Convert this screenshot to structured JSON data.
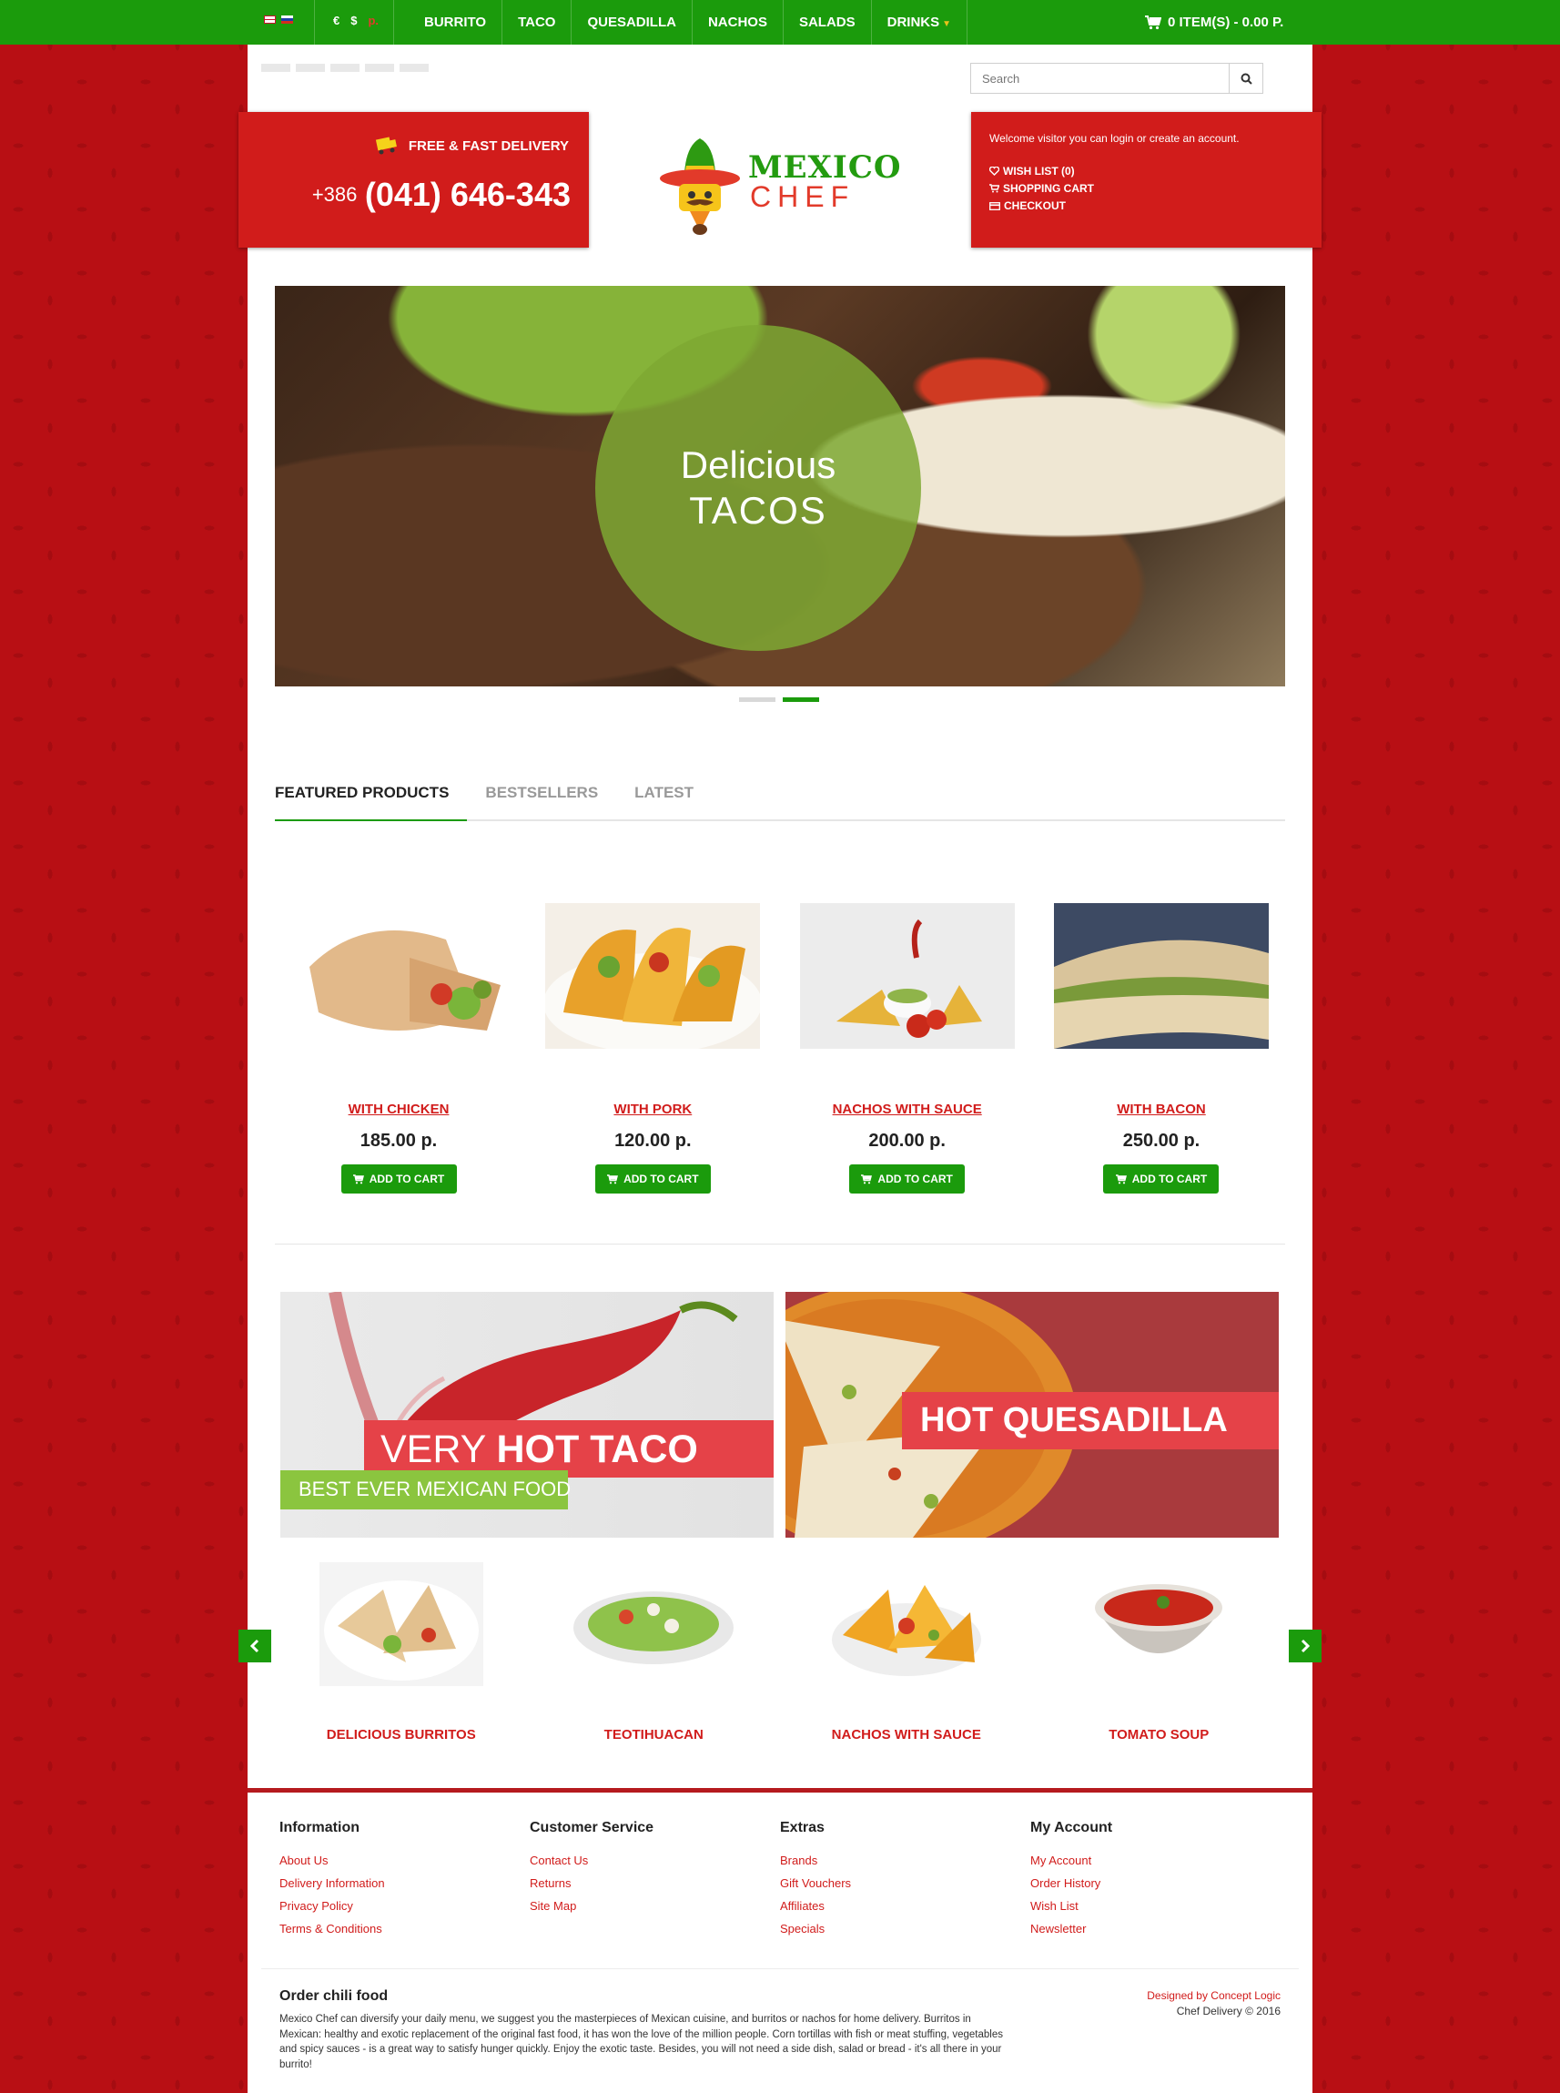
{
  "topbar": {
    "currencies": [
      "€",
      "$",
      "р."
    ],
    "nav": [
      "BURRITO",
      "TACO",
      "QUESADILLA",
      "NACHOS",
      "SALADS",
      "DRINKS"
    ],
    "cart": "0 ITEM(S) - 0.00 P."
  },
  "search": {
    "placeholder": "Search"
  },
  "delivery": {
    "label": "FREE & FAST DELIVERY",
    "phone_code": "+386",
    "phone_number": "(041) 646-343"
  },
  "logo": {
    "line1": "MEXICO",
    "line2": "CHEF"
  },
  "account": {
    "welcome": "Welcome visitor you can login or create an account.",
    "links": [
      "WISH LIST (0)",
      "SHOPPING CART",
      "CHECKOUT"
    ]
  },
  "slider": {
    "line1": "Delicious",
    "line2": "TACOS",
    "active_slide": 2,
    "total_slides": 2
  },
  "tabs": [
    "FEATURED PRODUCTS",
    "BESTSELLERS",
    "LATEST"
  ],
  "products": [
    {
      "name": "WITH CHICKEN",
      "price": "185.00 p.",
      "button": "ADD TO CART"
    },
    {
      "name": "WITH PORK",
      "price": "120.00 p.",
      "button": "ADD TO CART"
    },
    {
      "name": "NACHOS WITH SAUCE",
      "price": "200.00 p.",
      "button": "ADD TO CART"
    },
    {
      "name": "WITH BACON",
      "price": "250.00 p.",
      "button": "ADD TO CART"
    }
  ],
  "banners": {
    "taco_light": "VERY ",
    "taco_bold": "HOT TACO",
    "taco_sub": "BEST EVER MEXICAN FOOD",
    "quesadilla": "HOT QUESADILLA"
  },
  "categories": [
    "DELICIOUS BURRITOS",
    "TEOTIHUACAN",
    "NACHOS WITH SAUCE",
    "TOMATO SOUP"
  ],
  "footer": {
    "columns": [
      {
        "title": "Information",
        "links": [
          "About Us",
          "Delivery Information",
          "Privacy Policy",
          "Terms & Conditions"
        ]
      },
      {
        "title": "Customer Service",
        "links": [
          "Contact Us",
          "Returns",
          "Site Map"
        ]
      },
      {
        "title": "Extras",
        "links": [
          "Brands",
          "Gift Vouchers",
          "Affiliates",
          "Specials"
        ]
      },
      {
        "title": "My Account",
        "links": [
          "My Account",
          "Order History",
          "Wish List",
          "Newsletter"
        ]
      }
    ],
    "about_title": "Order chili food",
    "about_text": "Mexico Chef can diversify your daily menu, we suggest you the masterpieces of Mexican cuisine, and burritos or nachos for home delivery. Burritos in Mexican: healthy and exotic replacement of the original fast food, it has won the love of the million people. Corn tortillas with fish or meat stuffing, vegetables and spicy sauces - is a great way to satisfy hunger quickly. Enjoy the exotic taste. Besides, you will not need a side dish, salad or bread - it's all there in your burrito!",
    "designed_by": "Designed by Concept Logic",
    "copyright": "Chef Delivery © 2016"
  },
  "colors": {
    "brand_green": "#1b9b0c",
    "brand_red": "#d11c1b",
    "banner_red": "#e54248",
    "banner_green": "#8bc53f"
  }
}
